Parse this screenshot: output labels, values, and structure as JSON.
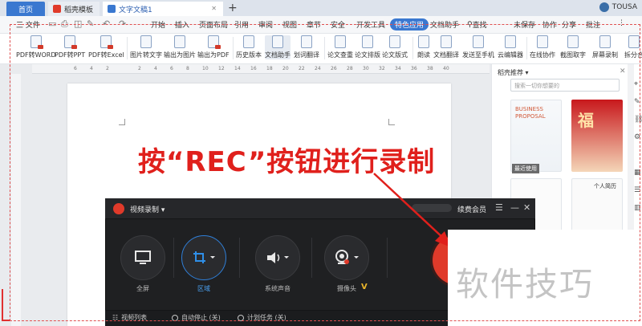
{
  "titlebar": {
    "tab_home": "首页",
    "tab_template": "稻壳模板",
    "tab_doc": "文字文稿1",
    "new_tab": "+",
    "user": "TOUSA"
  },
  "menubar": {
    "file": "三 文件",
    "items": [
      "开始",
      "插入",
      "页面布局",
      "引用",
      "审阅",
      "视图",
      "章节",
      "安全",
      "开发工具"
    ],
    "special": "特色应用",
    "doc_helper": "文档助手",
    "search": "查找",
    "unsaved": "未保存",
    "collab": "协作",
    "share": "分享",
    "comment": "批注"
  },
  "ribbon": {
    "buttons": [
      "PDF转WORD",
      "PDF转PPT",
      "PDF转Excel",
      "图片转文字",
      "输出为图片",
      "输出为PDF",
      "历史版本",
      "文档助手",
      "划词翻译",
      "论文查重",
      "论文排版",
      "论文版式",
      "朗读",
      "文档翻译",
      "发送至手机",
      "云编辑器",
      "在线协作",
      "截图取字",
      "屏幕录制",
      "拆分合"
    ]
  },
  "ruler": [
    "6",
    "4",
    "2",
    "2",
    "4",
    "6",
    "8",
    "10",
    "12",
    "14",
    "16",
    "18",
    "20",
    "22",
    "24",
    "26",
    "28",
    "30",
    "32",
    "34",
    "36",
    "38",
    "40"
  ],
  "document": {
    "caption": "按“REC”按钮进行录制"
  },
  "right_panel": {
    "title": "稻壳推荐 ▾",
    "search_placeholder": "搜索一切你想要的",
    "badge": "最近使用",
    "thumb1_title": "BUSINESS PROPOSAL",
    "thumb2_title": "福",
    "thumb4_title": "个人简历"
  },
  "recorder": {
    "title": "视频录制 ▾",
    "member": "续费会员",
    "modes": [
      "全屏",
      "区域",
      "系统声音",
      "摄像头"
    ],
    "footer": [
      "视频列表",
      "自动停止 (关)",
      "计划任务 (关)"
    ]
  },
  "watermark": "软件技巧",
  "colors": {
    "accent": "#3a78d0",
    "caption_red": "#e0201c",
    "rec_red": "#e03a2a",
    "recorder_bg": "#1f2022"
  }
}
